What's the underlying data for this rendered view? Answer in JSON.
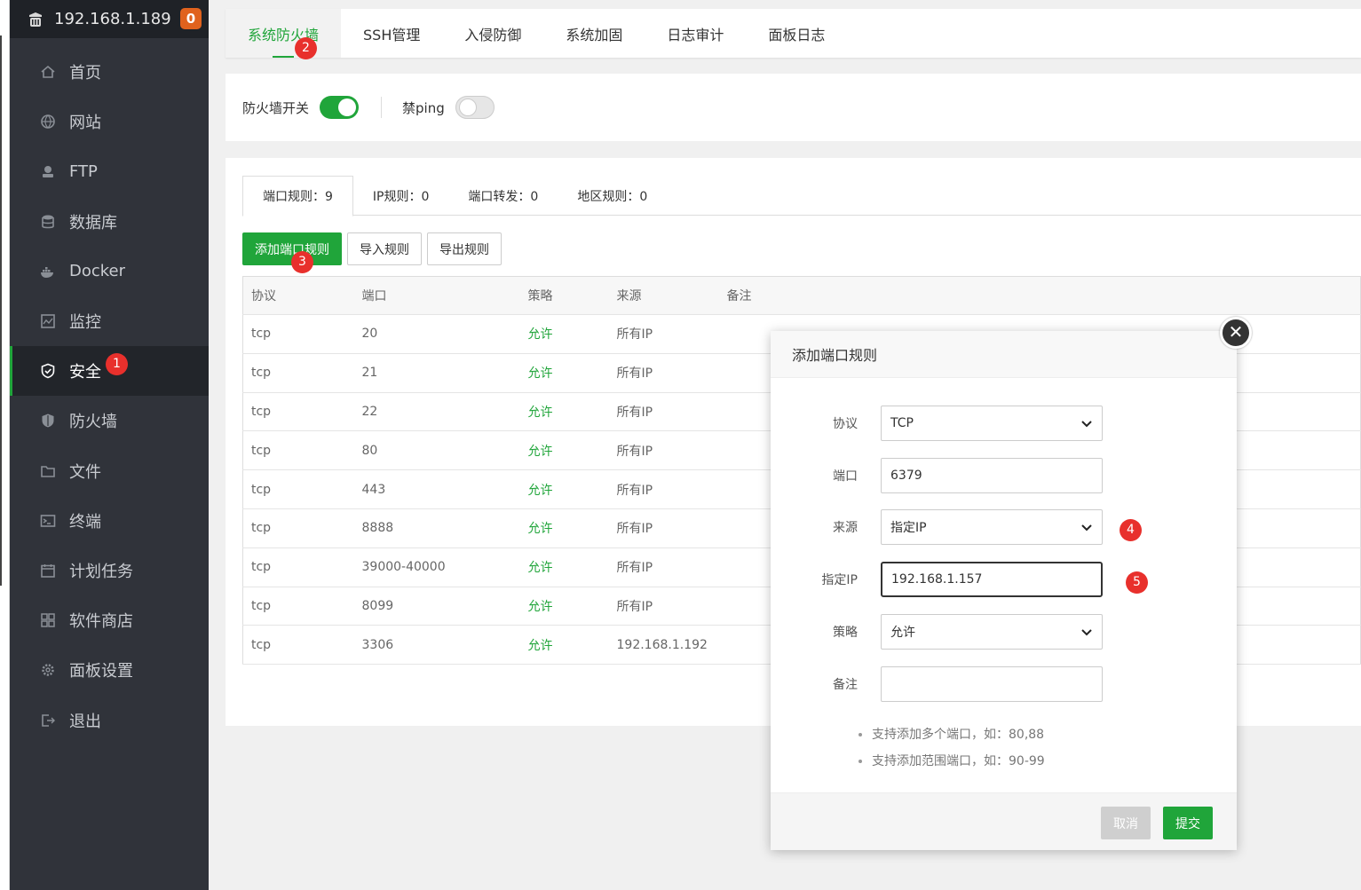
{
  "header": {
    "ip": "192.168.1.189",
    "badge": "0"
  },
  "sidebar": {
    "items": [
      {
        "label": "首页",
        "icon": "home-icon"
      },
      {
        "label": "网站",
        "icon": "globe-icon"
      },
      {
        "label": "FTP",
        "icon": "ftp-icon"
      },
      {
        "label": "数据库",
        "icon": "database-icon"
      },
      {
        "label": "Docker",
        "icon": "docker-icon"
      },
      {
        "label": "监控",
        "icon": "monitor-icon"
      },
      {
        "label": "安全",
        "icon": "shield-check-icon",
        "active": true,
        "step": "1"
      },
      {
        "label": "防火墙",
        "icon": "shield-icon"
      },
      {
        "label": "文件",
        "icon": "folder-icon"
      },
      {
        "label": "终端",
        "icon": "terminal-icon"
      },
      {
        "label": "计划任务",
        "icon": "calendar-icon"
      },
      {
        "label": "软件商店",
        "icon": "apps-icon"
      },
      {
        "label": "面板设置",
        "icon": "gear-icon"
      },
      {
        "label": "退出",
        "icon": "logout-icon"
      }
    ]
  },
  "topnav": {
    "tabs": [
      "系统防火墙",
      "SSH管理",
      "入侵防御",
      "系统加固",
      "日志审计",
      "面板日志"
    ],
    "step": "2"
  },
  "switches": {
    "firewall_label": "防火墙开关",
    "firewall_on": true,
    "ping_label": "禁ping",
    "ping_on": false
  },
  "subtabs": [
    "端口规则：9",
    "IP规则：0",
    "端口转发：0",
    "地区规则：0"
  ],
  "buttons": {
    "add": "添加端口规则",
    "import": "导入规则",
    "export": "导出规则",
    "step": "3"
  },
  "table": {
    "headers": [
      "协议",
      "端口",
      "策略",
      "来源",
      "备注"
    ],
    "rows": [
      [
        "tcp",
        "20",
        "允许",
        "所有IP",
        ""
      ],
      [
        "tcp",
        "21",
        "允许",
        "所有IP",
        ""
      ],
      [
        "tcp",
        "22",
        "允许",
        "所有IP",
        ""
      ],
      [
        "tcp",
        "80",
        "允许",
        "所有IP",
        ""
      ],
      [
        "tcp",
        "443",
        "允许",
        "所有IP",
        ""
      ],
      [
        "tcp",
        "8888",
        "允许",
        "所有IP",
        ""
      ],
      [
        "tcp",
        "39000-40000",
        "允许",
        "所有IP",
        ""
      ],
      [
        "tcp",
        "8099",
        "允许",
        "所有IP",
        ""
      ],
      [
        "tcp",
        "3306",
        "允许",
        "192.168.1.192",
        ""
      ]
    ]
  },
  "modal": {
    "title": "添加端口规则",
    "close": "✕",
    "fields": {
      "protocol": {
        "label": "协议",
        "value": "TCP"
      },
      "port": {
        "label": "端口",
        "value": "6379"
      },
      "source": {
        "label": "来源",
        "value": "指定IP",
        "step": "4"
      },
      "ip": {
        "label": "指定IP",
        "value": "192.168.1.157",
        "step": "5"
      },
      "policy": {
        "label": "策略",
        "value": "允许"
      },
      "remark": {
        "label": "备注",
        "value": ""
      }
    },
    "tips": [
      "支持添加多个端口，如：80,88",
      "支持添加范围端口，如：90-99"
    ],
    "cancel": "取消",
    "submit": "提交"
  },
  "colors": {
    "accent": "#20a53a",
    "sidebar": "#30333a",
    "badge": "#e0621d",
    "step_dot": "#e8302c"
  }
}
